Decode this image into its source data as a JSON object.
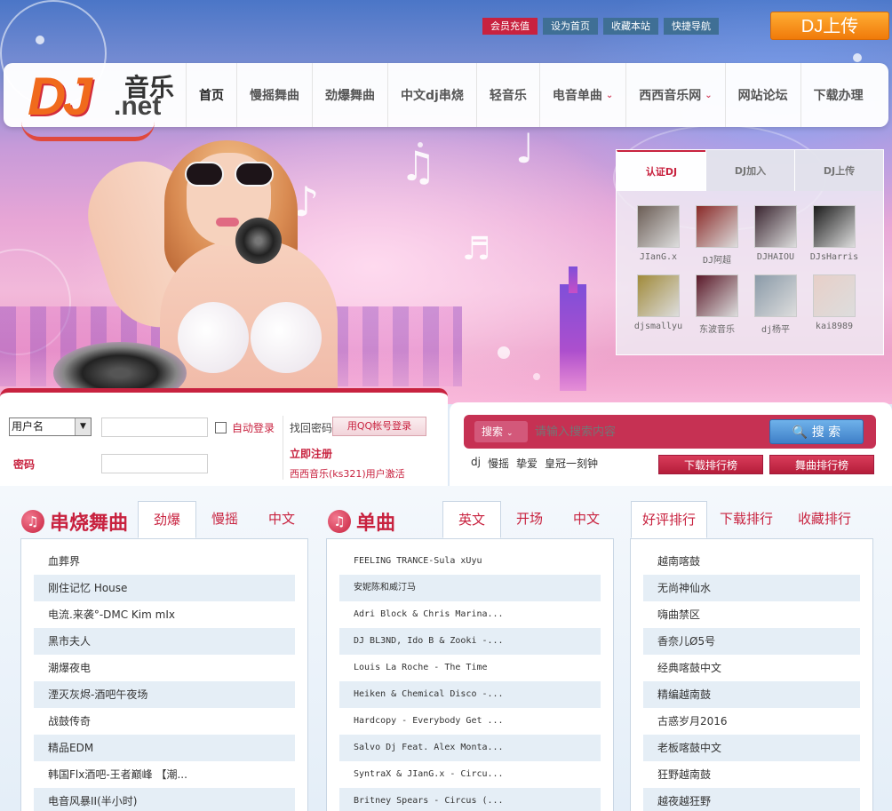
{
  "topbar": {
    "links": [
      "会员充值",
      "设为首页",
      "收藏本站",
      "快捷导航"
    ],
    "upload_label": "DJ上传"
  },
  "logo": {
    "main": "DJ",
    "cn": "音乐",
    "net": ".net"
  },
  "nav": {
    "items": [
      {
        "label": "首页"
      },
      {
        "label": "慢摇舞曲"
      },
      {
        "label": "劲爆舞曲"
      },
      {
        "label": "中文dj串烧"
      },
      {
        "label": "轻音乐"
      },
      {
        "label": "电音单曲",
        "caret": "⌄"
      },
      {
        "label": "西西音乐网",
        "caret": "⌄"
      },
      {
        "label": "网站论坛"
      },
      {
        "label": "下载办理"
      }
    ]
  },
  "dj_panel": {
    "tabs": [
      "认证DJ",
      "DJ加入",
      "DJ上传"
    ],
    "djs": [
      {
        "name": "JIanG.x",
        "color": "#6b5d55"
      },
      {
        "name": "DJ阿超",
        "color": "#8a2a28"
      },
      {
        "name": "DJHAIOU",
        "color": "#3a2530"
      },
      {
        "name": "DJsHarris",
        "color": "#1b1b1b"
      },
      {
        "name": "djsmallyu",
        "color": "#a08a3a"
      },
      {
        "name": "东波音乐",
        "color": "#5a1828"
      },
      {
        "name": "dj杨平",
        "color": "#8a9aa8"
      },
      {
        "name": "kai8989",
        "color": "#e7cfc8"
      }
    ]
  },
  "login": {
    "user_select": "用户名",
    "password_label": "密码",
    "auto_login": "自动登录",
    "find_password": "找回密码",
    "qq_login": "用QQ帐号登录",
    "register": "立即注册",
    "activate": "西西音乐(ks321)用户激活"
  },
  "search": {
    "select_label": "搜索",
    "placeholder": "请输入搜索内容",
    "button_label": "搜 索",
    "hotwords": [
      "dj",
      "慢摇",
      "挚爱",
      "皇冠一刻钟"
    ],
    "download_rank": "下载排行榜",
    "dance_rank": "舞曲排行榜"
  },
  "section_mix": {
    "title": "串烧舞曲",
    "tabs": [
      "劲爆",
      "慢摇",
      "中文"
    ],
    "items": [
      "血葬界",
      "刚住记忆 House",
      "电流.来袭°-DMC Kim mIx",
      "黑市夫人",
      "潮爆夜电",
      "湮灭灰烬-酒吧午夜场",
      "战鼓传奇",
      "精品EDM",
      "韩国Flx酒吧-王者巅峰 【潮...",
      "电音风暴II(半小时)"
    ]
  },
  "section_single": {
    "title": "单曲",
    "tabs": [
      "英文",
      "开场",
      "中文"
    ],
    "items": [
      "FEELING TRANCE-Sula xUyu",
      "安妮陈和威汀马",
      "Adri Block & Chris Marina...",
      "DJ BL3ND, Ido B & Zooki -...",
      "Louis La Roche - The Time",
      "Heiken & Chemical Disco -...",
      "Hardcopy - Everybody Get ...",
      "Salvo Dj Feat. Alex Monta...",
      "SyntraX & JIanG.x - Circu...",
      "Britney Spears - Circus (..."
    ]
  },
  "section_rank": {
    "tabs": [
      "好评排行",
      "下载排行",
      "收藏排行"
    ],
    "items": [
      "越南喀鼓",
      "无尚神仙水",
      "嗨曲禁区",
      "香奈儿Ø5号",
      "经典喀鼓中文",
      "精编越南鼓",
      "古惑岁月2016",
      "老板喀鼓中文",
      "狂野越南鼓",
      "越夜越狂野"
    ]
  }
}
